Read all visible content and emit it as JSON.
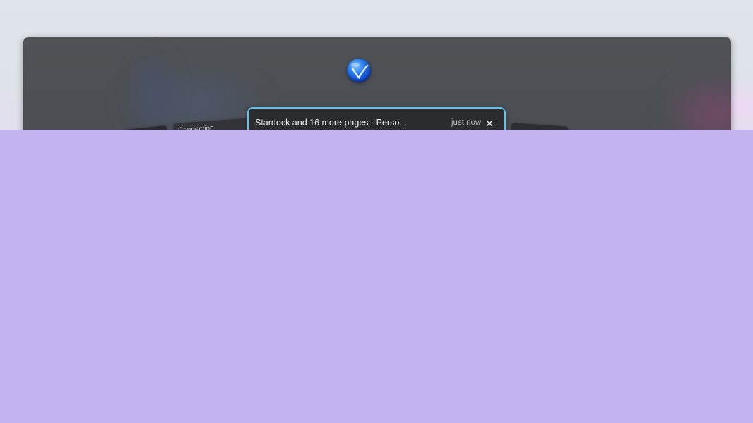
{
  "task_switcher": {
    "focused_window": {
      "title": "Stardock and 16 more pages - Perso...",
      "timestamp": "just now",
      "close_icon": "close-icon"
    },
    "left_window": {
      "label": "Connection"
    },
    "app_icon": "globe-logo-icon"
  },
  "colors": {
    "panel_background": "#4f5356",
    "focus_border": "#5cc2ee",
    "card_background": "#2b2c2e",
    "lower_overlay": "#c2b2ee"
  }
}
